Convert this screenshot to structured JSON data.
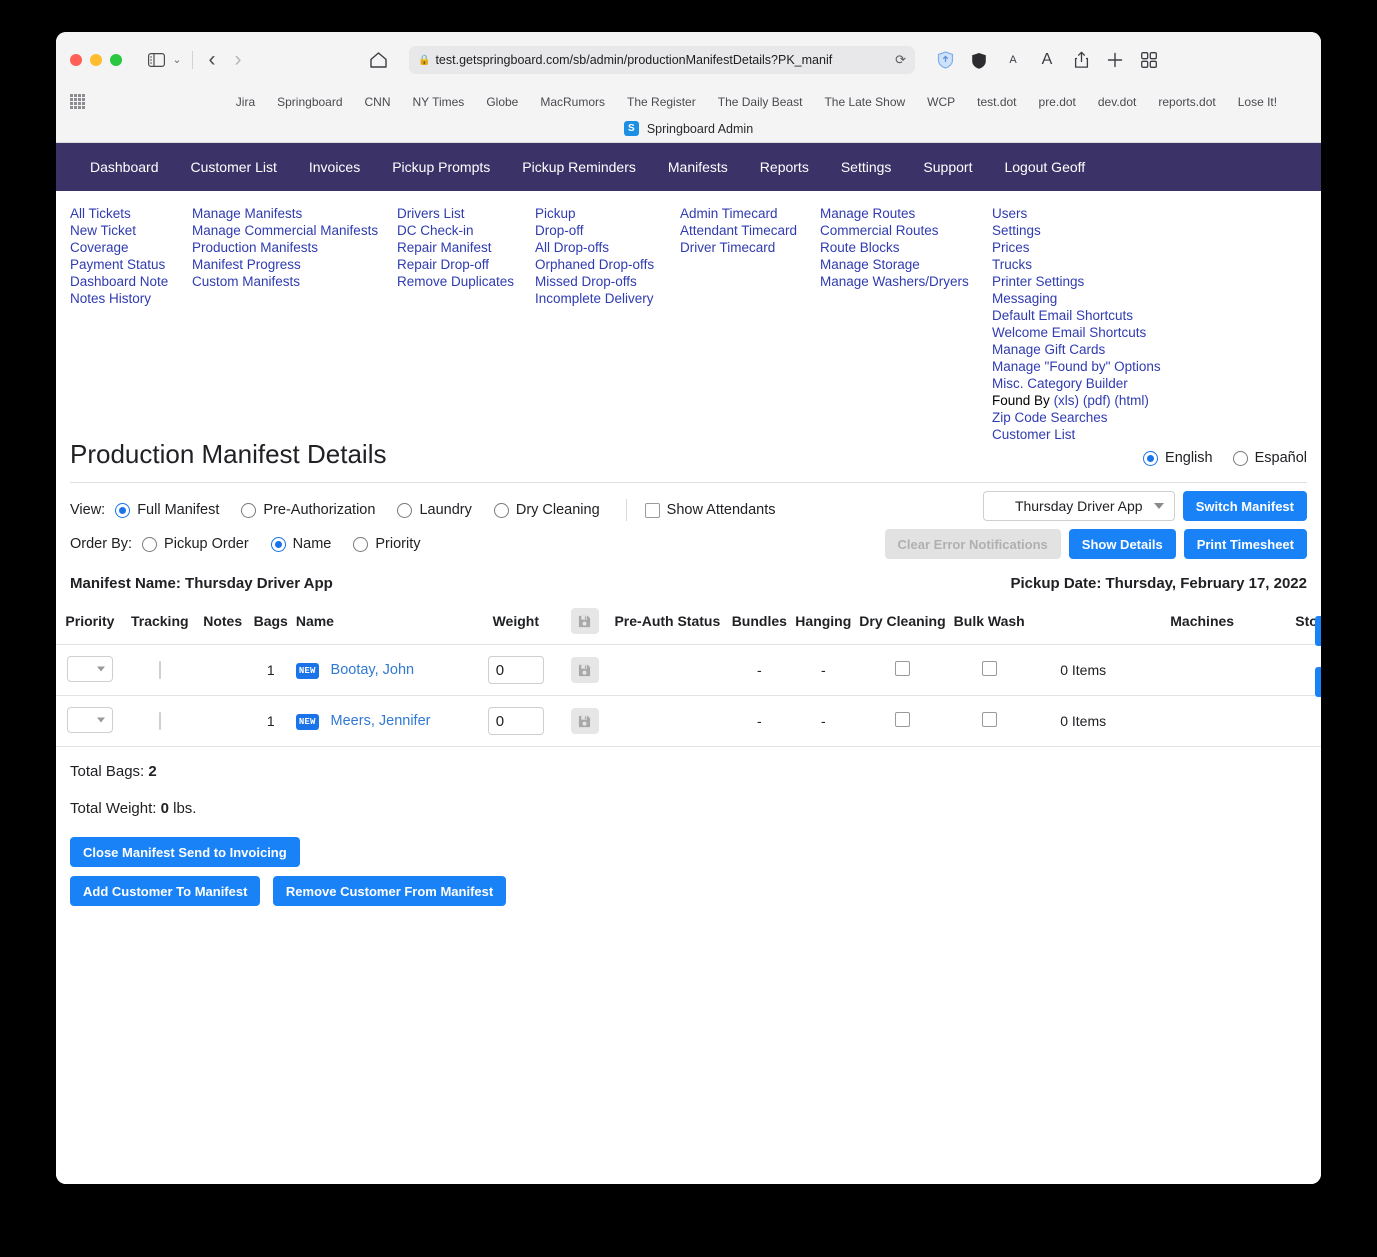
{
  "browser": {
    "url": "test.getspringboard.com/sb/admin/productionManifestDetails?PK_manif",
    "tab_title": "Springboard Admin",
    "favicon_letter": "S",
    "bookmarks": [
      "Jira",
      "Springboard",
      "CNN",
      "NY Times",
      "Globe",
      "MacRumors",
      "The Register",
      "The Daily Beast",
      "The Late Show",
      "WCP",
      "test.dot",
      "pre.dot",
      "dev.dot",
      "reports.dot",
      "Lose It!"
    ]
  },
  "navbar": {
    "items": [
      "Dashboard",
      "Customer List",
      "Invoices",
      "Pickup Prompts",
      "Pickup Reminders",
      "Manifests",
      "Reports",
      "Settings",
      "Support",
      "Logout Geoff"
    ]
  },
  "linkgrid": {
    "col1": [
      "All Tickets",
      "New Ticket",
      "Coverage",
      "Payment Status",
      "Dashboard Note",
      "Notes History"
    ],
    "col2": [
      "Manage Manifests",
      "Manage Commercial Manifests",
      "Production Manifests",
      "Manifest Progress",
      "Custom Manifests"
    ],
    "col3": [
      "Drivers List",
      "DC Check-in",
      "Repair Manifest",
      "Repair Drop-off",
      "Remove Duplicates"
    ],
    "col4": [
      "Pickup",
      "Drop-off",
      "All Drop-offs",
      "Orphaned Drop-offs",
      "Missed Drop-offs",
      "Incomplete Delivery"
    ],
    "col5": [
      "Admin Timecard",
      "Attendant Timecard",
      "Driver Timecard"
    ],
    "col6": [
      "Manage Routes",
      "Commercial Routes",
      "Route Blocks",
      "Manage Storage",
      "Manage Washers/Dryers"
    ],
    "col7_top": [
      "Users",
      "Settings",
      "Prices",
      "Trucks",
      "Printer Settings",
      "Messaging",
      "Default Email Shortcuts",
      "Welcome Email Shortcuts",
      "Manage Gift Cards",
      "Manage \"Found by\" Options",
      "Misc. Category Builder"
    ],
    "found_by_label": "Found By",
    "found_by_links": [
      "(xls)",
      "(pdf)",
      "(html)"
    ],
    "col7_bottom": [
      "Zip Code Searches",
      "Customer List"
    ]
  },
  "header": {
    "title": "Production Manifest Details",
    "language": {
      "english": "English",
      "espanol": "Español",
      "selected": "English"
    }
  },
  "controls": {
    "view_label": "View:",
    "view_options": [
      "Full Manifest",
      "Pre-Authorization",
      "Laundry",
      "Dry Cleaning"
    ],
    "view_selected": "Full Manifest",
    "show_attendants_label": "Show Attendants",
    "show_attendants_checked": false,
    "order_label": "Order By:",
    "order_options": [
      "Pickup Order",
      "Name",
      "Priority"
    ],
    "order_selected": "Name",
    "manifest_select_value": "Thursday Driver App",
    "switch_manifest_label": "Switch Manifest",
    "clear_errors_label": "Clear Error Notifications",
    "show_details_label": "Show Details",
    "print_timesheet_label": "Print Timesheet"
  },
  "meta": {
    "manifest_name": "Manifest Name: Thursday Driver App",
    "pickup_date": "Pickup Date: Thursday, February 17, 2022"
  },
  "table": {
    "headers": [
      "Priority",
      "Tracking",
      "Notes",
      "Bags",
      "Name",
      "Weight",
      "save-icon",
      "Pre-Auth Status",
      "Bundles",
      "Hanging",
      "Dry Cleaning",
      "Bulk Wash",
      "",
      "Machines",
      "Storage"
    ],
    "rows": [
      {
        "priority": "",
        "tracking": "",
        "notes": "",
        "bags": "1",
        "badge": "NEW",
        "name": "Bootay, John",
        "weight": "0",
        "pre_auth_status": "",
        "bundles": "-",
        "hanging": "-",
        "dry_cleaning_checked": false,
        "bulk_wash_checked": false,
        "items": "0 Items",
        "machines": "",
        "storage": ""
      },
      {
        "priority": "",
        "tracking": "",
        "notes": "",
        "bags": "1",
        "badge": "NEW",
        "name": "Meers, Jennifer",
        "weight": "0",
        "pre_auth_status": "",
        "bundles": "-",
        "hanging": "-",
        "dry_cleaning_checked": false,
        "bulk_wash_checked": false,
        "items": "0 Items",
        "machines": "",
        "storage": ""
      }
    ]
  },
  "totals": {
    "bags_label": "Total Bags:",
    "bags_value": "2",
    "weight_label": "Total Weight:",
    "weight_value": "0",
    "weight_unit": "lbs."
  },
  "actions": {
    "close_manifest": "Close Manifest Send to Invoicing",
    "add_customer": "Add Customer To Manifest",
    "remove_customer": "Remove Customer From Manifest"
  },
  "colors": {
    "nav_purple": "#3b3368",
    "link_blue": "#2f3bb0",
    "button_blue": "#1a82f7",
    "accent_blue": "#1a73e8"
  }
}
